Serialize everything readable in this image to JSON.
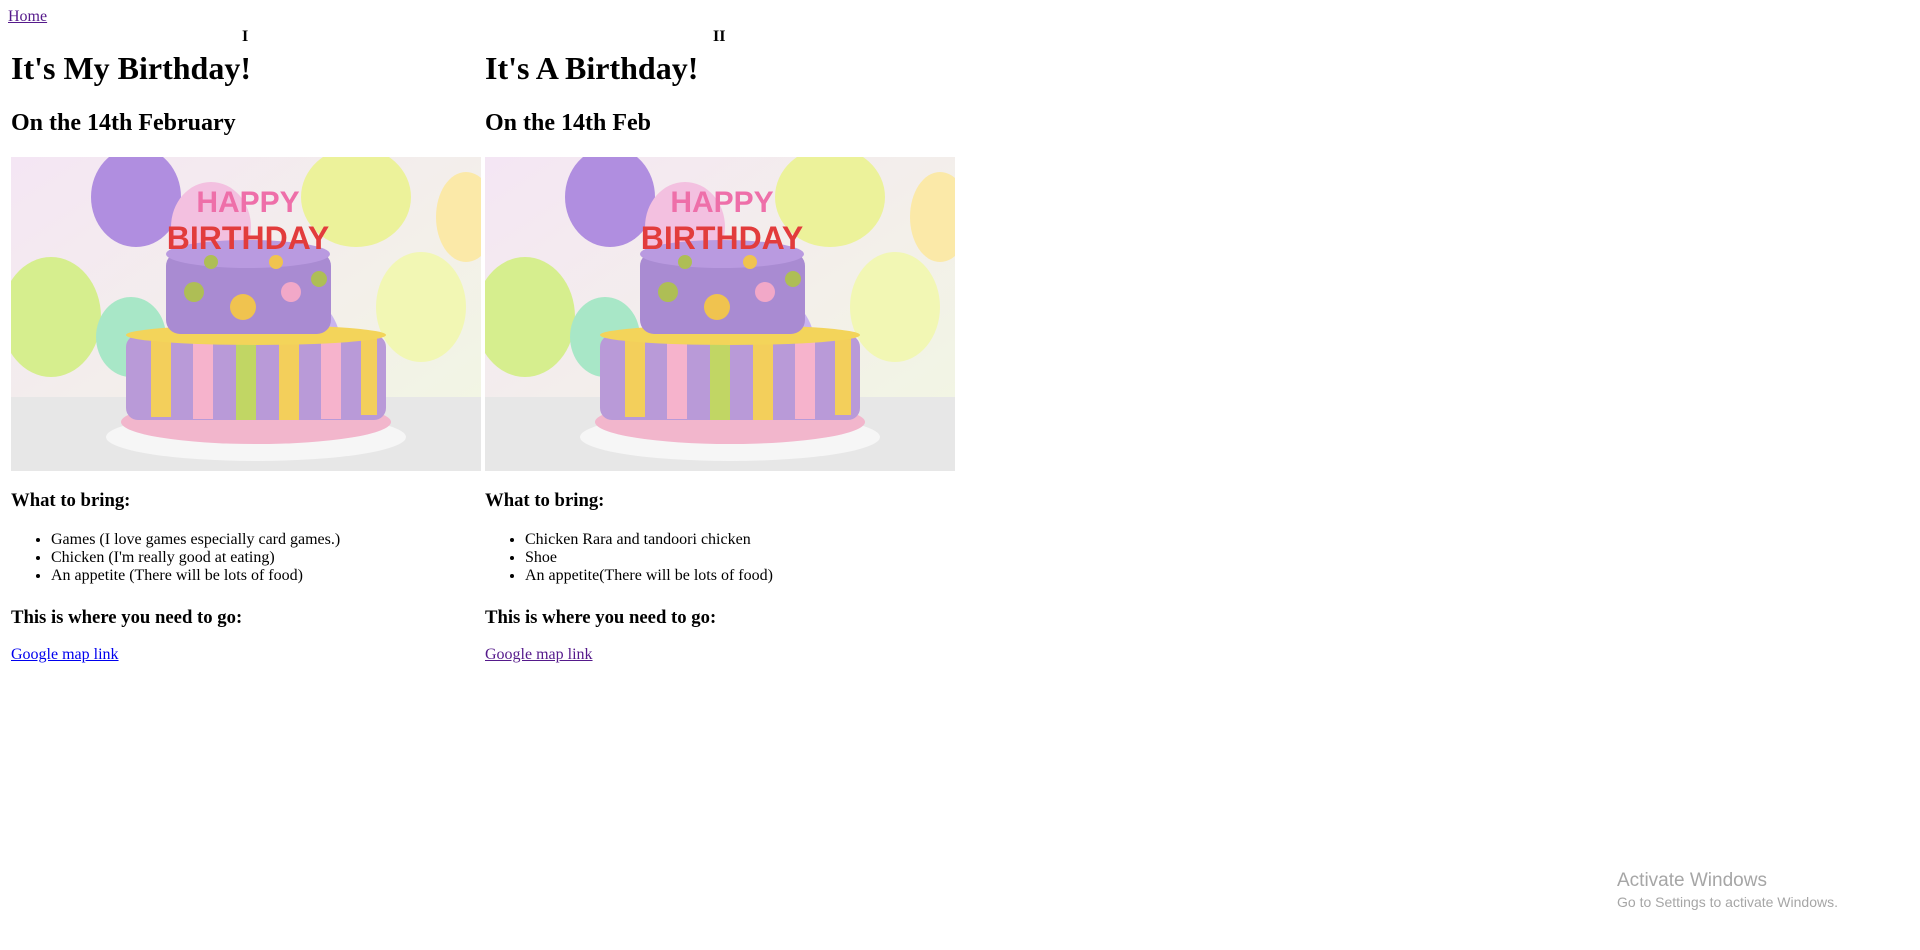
{
  "nav": {
    "home_label": "Home"
  },
  "columns": [
    {
      "numeral": "I",
      "title": "It's My Birthday!",
      "date": "On the 14th February",
      "bring_heading": "What to bring:",
      "items": [
        "Games (I love games especially card games.)",
        "Chicken (I'm really good at eating)",
        "An appetite (There will be lots of food)"
      ],
      "where_heading": "This is where you need to go:",
      "map_link": "Google map link",
      "cake_text": "HAPPY BIRTHDAY"
    },
    {
      "numeral": "II",
      "title": "It's A Birthday!",
      "date": "On the 14th Feb",
      "bring_heading": "What to bring:",
      "items": [
        "Chicken Rara and tandoori chicken",
        "Shoe",
        "An appetite(There will be lots of food)"
      ],
      "where_heading": "This is where you need to go:",
      "map_link": "Google map link",
      "cake_text": "HAPPY BIRTHDAY"
    }
  ],
  "watermark": {
    "title": "Activate Windows",
    "subtitle": "Go to Settings to activate Windows."
  },
  "colors": {
    "link_unvisited": "#0000ee",
    "link_visited": "#551a8b",
    "watermark": "#a6a6a6"
  }
}
